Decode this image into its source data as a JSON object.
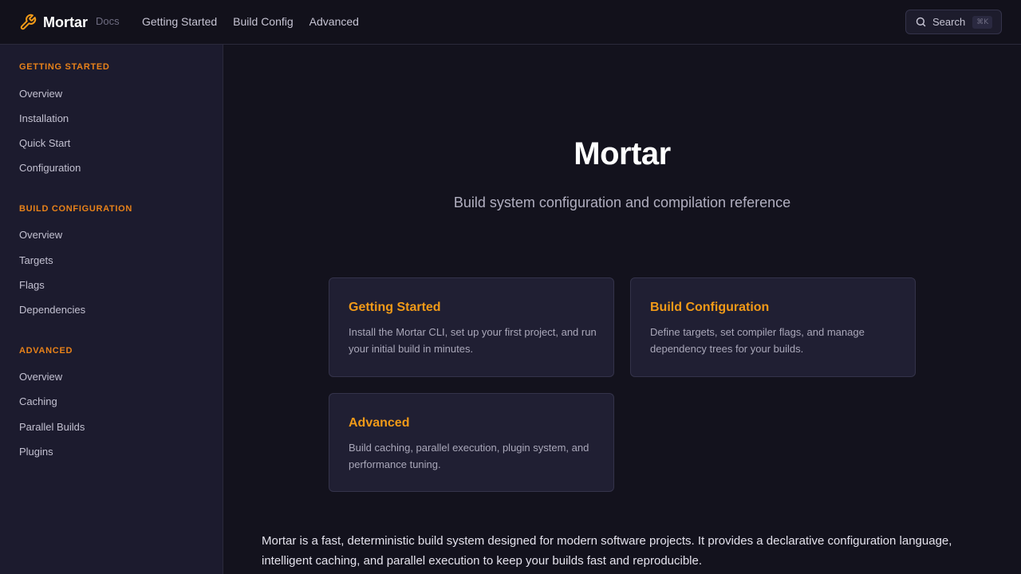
{
  "header": {
    "brand_name": "Mortar",
    "brand_tag": "Docs",
    "brand_icon": "wrench-icon",
    "nav": [
      {
        "label": "Getting Started"
      },
      {
        "label": "Build Config"
      },
      {
        "label": "Advanced"
      }
    ],
    "search": {
      "label": "Search",
      "shortcut": "⌘K",
      "icon": "search-icon"
    }
  },
  "sidebar": {
    "sections": [
      {
        "title": "GETTING STARTED",
        "items": [
          {
            "label": "Overview"
          },
          {
            "label": "Installation"
          },
          {
            "label": "Quick Start"
          },
          {
            "label": "Configuration"
          }
        ]
      },
      {
        "title": "BUILD CONFIGURATION",
        "items": [
          {
            "label": "Overview"
          },
          {
            "label": "Targets"
          },
          {
            "label": "Flags"
          },
          {
            "label": "Dependencies"
          }
        ]
      },
      {
        "title": "ADVANCED",
        "items": [
          {
            "label": "Overview"
          },
          {
            "label": "Caching"
          },
          {
            "label": "Parallel Builds"
          },
          {
            "label": "Plugins"
          }
        ]
      }
    ]
  },
  "main": {
    "title": "Mortar",
    "subtitle": "Build system configuration and compilation reference",
    "cards": [
      {
        "title": "Getting Started",
        "description": "Install the Mortar CLI, set up your first project, and run your initial build in minutes."
      },
      {
        "title": "Build Configuration",
        "description": "Define targets, set compiler flags, and manage dependency trees for your builds."
      },
      {
        "title": "Advanced",
        "description": "Build caching, parallel execution, plugin system, and performance tuning."
      }
    ],
    "intro": "Mortar is a fast, deterministic build system designed for modern software projects. It provides a declarative configuration language, intelligent caching, and parallel execution to keep your builds fast and reproducible."
  },
  "colors": {
    "accent": "#f19a18",
    "section_heading": "#e8821a",
    "background": "#13121d",
    "sidebar_bg": "#1c1b2e",
    "card_bg": "#201f33"
  }
}
